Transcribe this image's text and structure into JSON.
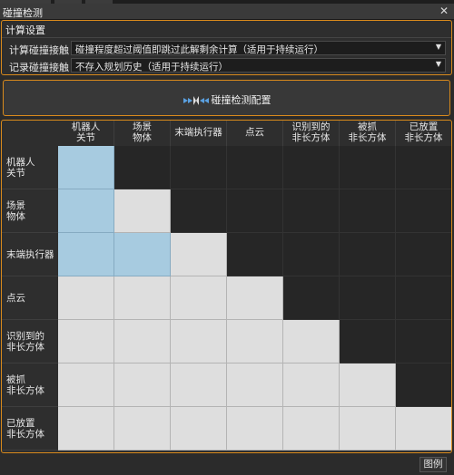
{
  "window": {
    "title": "碰撞检测",
    "close_glyph": "✕"
  },
  "settings": {
    "group_title": "计算设置",
    "rows": [
      {
        "label": "计算碰撞接触",
        "value": "碰撞程度超过阈值即跳过此解剩余计算（适用于持续运行）"
      },
      {
        "label": "记录碰撞接触",
        "value": "不存入规划历史（适用于持续运行）"
      }
    ]
  },
  "config_button": {
    "label": "碰撞检测配置",
    "icon": "collision-config-icon"
  },
  "matrix": {
    "columns": [
      "机器人\n关节",
      "场景\n物体",
      "末端执行器",
      "点云",
      "识别到的\n非长方体",
      "被抓\n非长方体",
      "已放置\n非长方体"
    ],
    "rows": [
      "机器人\n关节",
      "场景\n物体",
      "末端执行器",
      "点云",
      "识别到的\n非长方体",
      "被抓\n非长方体",
      "已放置\n非长方体"
    ],
    "cell_states": [
      [
        "blue",
        "dark",
        "dark",
        "dark",
        "dark",
        "dark",
        "dark"
      ],
      [
        "blue",
        "light",
        "dark",
        "dark",
        "dark",
        "dark",
        "dark"
      ],
      [
        "blue",
        "blue",
        "light",
        "dark",
        "dark",
        "dark",
        "dark"
      ],
      [
        "light",
        "light",
        "light",
        "light",
        "dark",
        "dark",
        "dark"
      ],
      [
        "light",
        "light",
        "light",
        "light",
        "light",
        "dark",
        "dark"
      ],
      [
        "light",
        "light",
        "light",
        "light",
        "light",
        "light",
        "dark"
      ],
      [
        "light",
        "light",
        "light",
        "light",
        "light",
        "light",
        "light"
      ]
    ],
    "colors": {
      "blue": "#a7cbe0",
      "light": "#dedede",
      "dark": "#262626",
      "accent": "#d98a1c"
    }
  },
  "footer": {
    "legend_label": "图例"
  }
}
